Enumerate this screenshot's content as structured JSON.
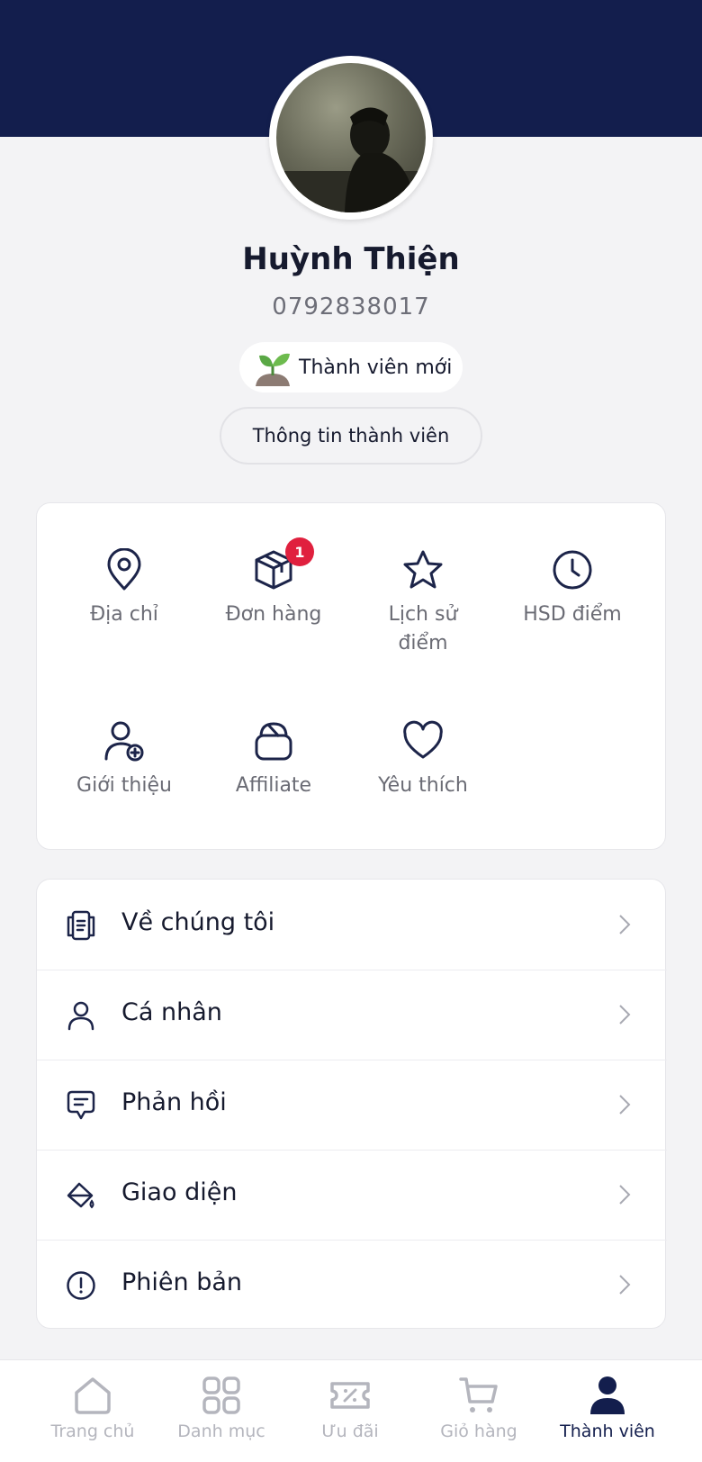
{
  "profile": {
    "name": "Huỳnh Thiện",
    "phone": "0792838017",
    "rank_label": "Thành viên mới",
    "member_info_button": "Thông tin thành viên"
  },
  "shortcuts": [
    {
      "label": "Địa chỉ",
      "icon": "location-pin-icon"
    },
    {
      "label": "Đơn hàng",
      "icon": "package-icon",
      "badge": "1"
    },
    {
      "label": "Lịch sử\nđiểm",
      "icon": "star-icon"
    },
    {
      "label": "HSD điểm",
      "icon": "clock-icon"
    },
    {
      "label": "Giới thiệu",
      "icon": "add-user-icon"
    },
    {
      "label": "Affiliate",
      "icon": "bag-icon"
    },
    {
      "label": "Yêu thích",
      "icon": "heart-icon"
    }
  ],
  "menu": [
    {
      "label": "Về chúng tôi",
      "icon": "store-info-icon"
    },
    {
      "label": "Cá nhân",
      "icon": "user-icon"
    },
    {
      "label": "Phản hồi",
      "icon": "feedback-icon"
    },
    {
      "label": "Giao diện",
      "icon": "paint-bucket-icon"
    },
    {
      "label": "Phiên bản",
      "icon": "info-alert-icon"
    }
  ],
  "bottom_nav": [
    {
      "label": "Trang chủ",
      "icon": "home-icon",
      "active": false
    },
    {
      "label": "Danh mục",
      "icon": "grid-icon",
      "active": false
    },
    {
      "label": "Ưu đãi",
      "icon": "voucher-icon",
      "active": false
    },
    {
      "label": "Giỏ hàng",
      "icon": "cart-icon",
      "active": false
    },
    {
      "label": "Thành viên",
      "icon": "member-icon",
      "active": true
    }
  ],
  "colors": {
    "header": "#131e4d",
    "icon_stroke": "#1c2449",
    "badge": "#e0203e",
    "nav_inactive": "#b4b5bd",
    "nav_active": "#131e4d"
  }
}
